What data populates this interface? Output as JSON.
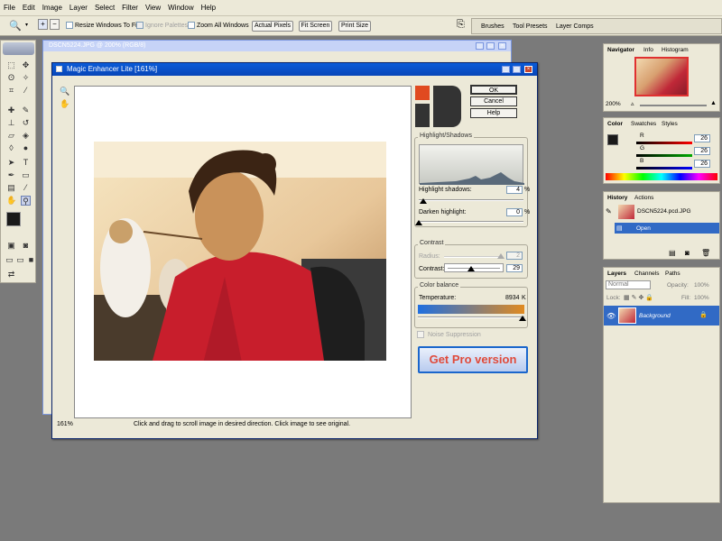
{
  "menu": [
    "File",
    "Edit",
    "Image",
    "Layer",
    "Select",
    "Filter",
    "View",
    "Window",
    "Help"
  ],
  "options": {
    "resize_windows": "Resize Windows To Fit",
    "ignore_palettes": "Ignore Palettes",
    "zoom_all": "Zoom All Windows",
    "actual_pixels": "Actual Pixels",
    "fit_screen": "Fit Screen",
    "print_size": "Print Size"
  },
  "well_tabs": [
    "Brushes",
    "Tool Presets",
    "Layer Comps"
  ],
  "document": {
    "title": "DSCN5224.JPG @ 200% (RGB/8)"
  },
  "navigator": {
    "tabs": [
      "Navigator",
      "Info",
      "Histogram"
    ],
    "zoom": "200%"
  },
  "color_panel": {
    "tabs": [
      "Color",
      "Swatches",
      "Styles"
    ],
    "r": "26",
    "g": "26",
    "b": "26"
  },
  "history": {
    "tabs": [
      "History",
      "Actions"
    ],
    "snapshot": "DSCN5224.pcd.JPG",
    "step": "Open"
  },
  "layers": {
    "tabs": [
      "Layers",
      "Channels",
      "Paths"
    ],
    "blend": "Normal",
    "opacity_label": "Opacity:",
    "opacity": "100%",
    "lock_label": "Lock:",
    "fill_label": "Fill:",
    "fill": "100%",
    "layer_name": "Background"
  },
  "dialog": {
    "title": "Magic Enhancer Lite [161%]",
    "ok": "OK",
    "cancel": "Cancel",
    "help": "Help",
    "hs_group": "Highlight/Shadows",
    "highlight_label": "Highlight shadows:",
    "highlight_val": "4",
    "darken_label": "Darken highlight:",
    "darken_val": "0",
    "pct": "%",
    "contrast_group": "Contrast",
    "radius_label": "Radius:",
    "radius_val": "2",
    "contrast_label": "Contrast:",
    "contrast_val": "29",
    "color_group": "Color balance",
    "temp_label": "Temperature:",
    "temp_val": "8934",
    "temp_unit": "K",
    "noise": "Noise Suppression",
    "pro": "Get Pro version",
    "zoom": "161%",
    "status": "Click and drag to scroll image in desired direction. Click image to see original."
  },
  "colors": {
    "accent": "#1a66cc",
    "pro_text": "#e04a3a",
    "title_blue": "#0a5bd8"
  },
  "progress": {
    "highlight_shadows_slider_fraction": 0.04,
    "darken_highlight_slider_fraction": 0.0,
    "contrast_slider_fraction": 0.45,
    "temperature_slider_fraction": 0.98
  }
}
